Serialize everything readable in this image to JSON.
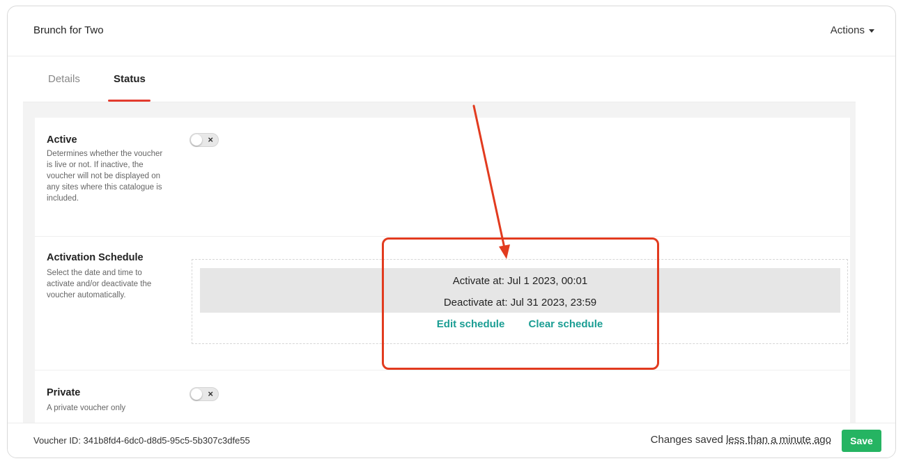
{
  "header": {
    "title": "Brunch for Two",
    "actions_label": "Actions"
  },
  "tabs": [
    {
      "label": "Details"
    },
    {
      "label": "Status"
    }
  ],
  "sections": {
    "active": {
      "title": "Active",
      "description": "Determines whether the voucher is live or not. If inactive, the voucher will not be displayed on any sites where this catalogue is included.",
      "toggle_state": "off"
    },
    "schedule": {
      "title": "Activation Schedule",
      "description": "Select the date and time to activate and/or deactivate the voucher automatically.",
      "activate_text": "Activate at: Jul 1 2023, 00:01",
      "deactivate_text": "Deactivate at: Jul 31 2023, 23:59",
      "edit_label": "Edit schedule",
      "clear_label": "Clear schedule"
    },
    "private": {
      "title": "Private",
      "description": "A private voucher only",
      "toggle_state": "off"
    }
  },
  "footer": {
    "voucher_id_text": "Voucher ID: 341b8fd4-6dc0-d8d5-95c5-5b307c3dfe55",
    "saved_prefix": "Changes saved",
    "saved_ago": "less than a minute ago",
    "save_label": "Save"
  },
  "colors": {
    "accent": "#1a9d93",
    "tab_underline": "#e33b2e",
    "save": "#25b462",
    "annotation": "#e23b1f"
  },
  "icons": {
    "toggle_off": "x-icon",
    "actions_caret": "caret-down-icon"
  }
}
